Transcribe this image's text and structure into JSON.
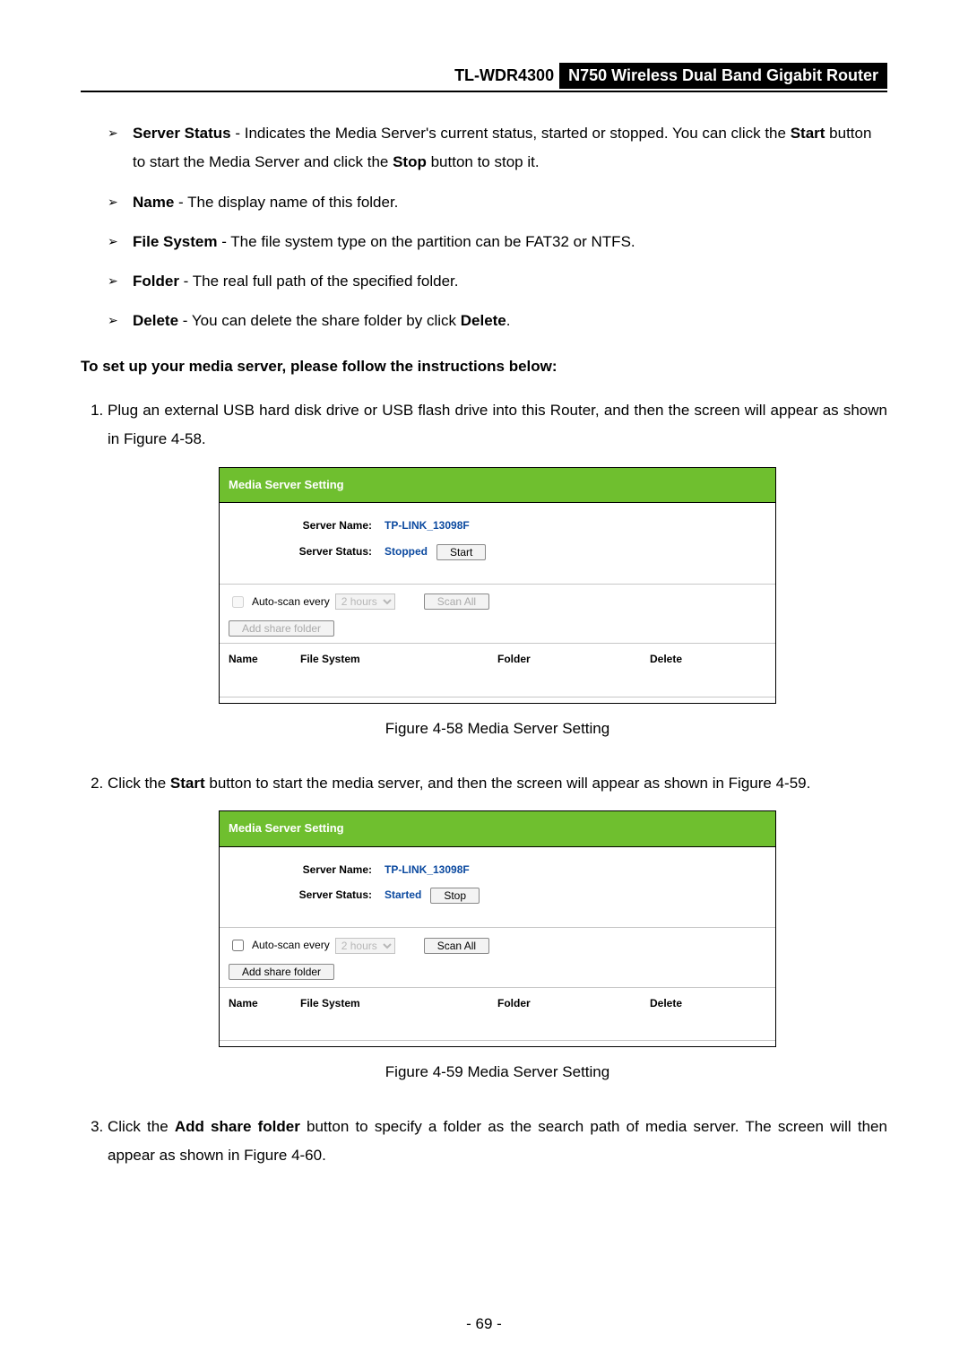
{
  "header": {
    "model": "TL-WDR4300",
    "product": "N750 Wireless Dual Band Gigabit Router"
  },
  "bullets": [
    {
      "term": "Server Status",
      "text_a": " - Indicates the Media Server's current status, started or stopped. You can click the ",
      "bold_a": "Start",
      "text_b": " button to start the Media Server and click the ",
      "bold_b": "Stop",
      "text_c": " button to stop it."
    },
    {
      "term": "Name",
      "text": " - The display name of this folder."
    },
    {
      "term": "File System",
      "text": " - The file system type on the partition can be FAT32 or NTFS."
    },
    {
      "term": "Folder",
      "text": " - The real full path of the specified folder."
    },
    {
      "term": "Delete",
      "text_a": " - You can delete the share folder by click ",
      "bold_a": "Delete",
      "text_b": "."
    }
  ],
  "instruction_heading": "To set up your media server, please follow the instructions below:",
  "steps": {
    "s1_a": "Plug an external USB hard disk drive or USB flash drive into this Router, and then the screen will appear as shown in ",
    "s1_link": "Figure 4-58",
    "s1_b": ".",
    "s2_a": "Click the ",
    "s2_bold": "Start",
    "s2_b": " button to start the media server, and then the screen will appear as shown in ",
    "s2_link": "Figure 4-59",
    "s2_c": ".",
    "s3_a": "Click the ",
    "s3_bold": "Add share folder",
    "s3_b": " button to specify a folder as the search path of media server. The screen will then appear as shown in ",
    "s3_link": "Figure 4-60",
    "s3_c": "."
  },
  "figure": {
    "title": "Media Server Setting",
    "server_name_label": "Server Name:",
    "server_name_value": "TP-LINK_13098F",
    "server_status_label": "Server Status:",
    "status_stopped": "Stopped",
    "status_started": "Started",
    "start_btn": "Start",
    "stop_btn": "Stop",
    "auto_scan_label": "Auto-scan every",
    "auto_scan_value": "2 hours",
    "scan_all_btn": "Scan All",
    "add_share_btn": "Add share folder",
    "col_name": "Name",
    "col_fs": "File System",
    "col_folder": "Folder",
    "col_delete": "Delete"
  },
  "captions": {
    "c58": "Figure 4-58 Media Server Setting",
    "c59": "Figure 4-59 Media Server Setting"
  },
  "page_number": "- 69 -"
}
